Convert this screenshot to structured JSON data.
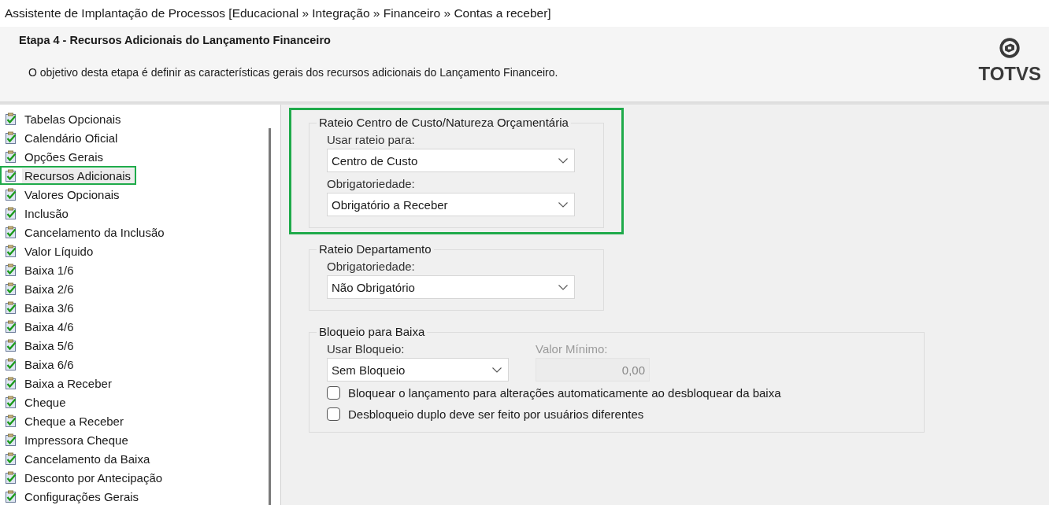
{
  "window": {
    "title": "Assistente de Implantação de Processos [Educacional » Integração » Financeiro » Contas a receber]"
  },
  "header": {
    "title": "Etapa 4 - Recursos Adicionais do Lançamento Financeiro",
    "description": "O objetivo desta etapa é definir as características gerais dos recursos adicionais do Lançamento Financeiro.",
    "logo": "TOTVS"
  },
  "steps": [
    {
      "label": "Tabelas Opcionais",
      "selected": false
    },
    {
      "label": "Calendário Oficial",
      "selected": false
    },
    {
      "label": "Opções Gerais",
      "selected": false
    },
    {
      "label": "Recursos Adicionais",
      "selected": true
    },
    {
      "label": "Valores Opcionais",
      "selected": false
    },
    {
      "label": "Inclusão",
      "selected": false
    },
    {
      "label": "Cancelamento da Inclusão",
      "selected": false
    },
    {
      "label": "Valor Líquido",
      "selected": false
    },
    {
      "label": "Baixa 1/6",
      "selected": false
    },
    {
      "label": "Baixa 2/6",
      "selected": false
    },
    {
      "label": "Baixa 3/6",
      "selected": false
    },
    {
      "label": "Baixa 4/6",
      "selected": false
    },
    {
      "label": "Baixa 5/6",
      "selected": false
    },
    {
      "label": "Baixa 6/6",
      "selected": false
    },
    {
      "label": "Baixa a Receber",
      "selected": false
    },
    {
      "label": "Cheque",
      "selected": false
    },
    {
      "label": "Cheque a Receber",
      "selected": false
    },
    {
      "label": "Impressora Cheque",
      "selected": false
    },
    {
      "label": "Cancelamento da Baixa",
      "selected": false
    },
    {
      "label": "Desconto por Antecipação",
      "selected": false
    },
    {
      "label": "Configurações Gerais",
      "selected": false
    }
  ],
  "groups": [
    {
      "title": "Rateio Centro de Custo/Natureza Orçamentária",
      "highlighted": true,
      "rows": [
        [
          {
            "kind": "combo",
            "label": "Usar rateio para:",
            "value": "Centro de Custo",
            "disabled": false
          }
        ],
        [
          {
            "kind": "combo",
            "label": "Obrigatoriedade:",
            "value": "Obrigatório a Receber",
            "disabled": false
          }
        ]
      ]
    },
    {
      "title": "Rateio Departamento",
      "highlighted": false,
      "rows": [
        [
          {
            "kind": "combo",
            "label": "Obrigatoriedade:",
            "value": "Não Obrigatório",
            "disabled": false
          }
        ]
      ]
    },
    {
      "title": "Bloqueio para Baixa",
      "highlighted": false,
      "rows": [
        [
          {
            "kind": "combo",
            "label": "Usar Bloqueio:",
            "value": "Sem Bloqueio",
            "disabled": false
          },
          {
            "kind": "number",
            "label": "Valor Mínimo:",
            "value": "0,00",
            "disabled": true
          }
        ],
        [
          {
            "kind": "checkbox",
            "label": "Bloquear o lançamento para alterações automaticamente ao desbloquear da baixa",
            "checked": false,
            "disabled": false
          }
        ],
        [
          {
            "kind": "checkbox",
            "label": "Desbloqueio duplo deve ser feito por usuários diferentes",
            "checked": false,
            "disabled": false
          }
        ]
      ]
    }
  ]
}
